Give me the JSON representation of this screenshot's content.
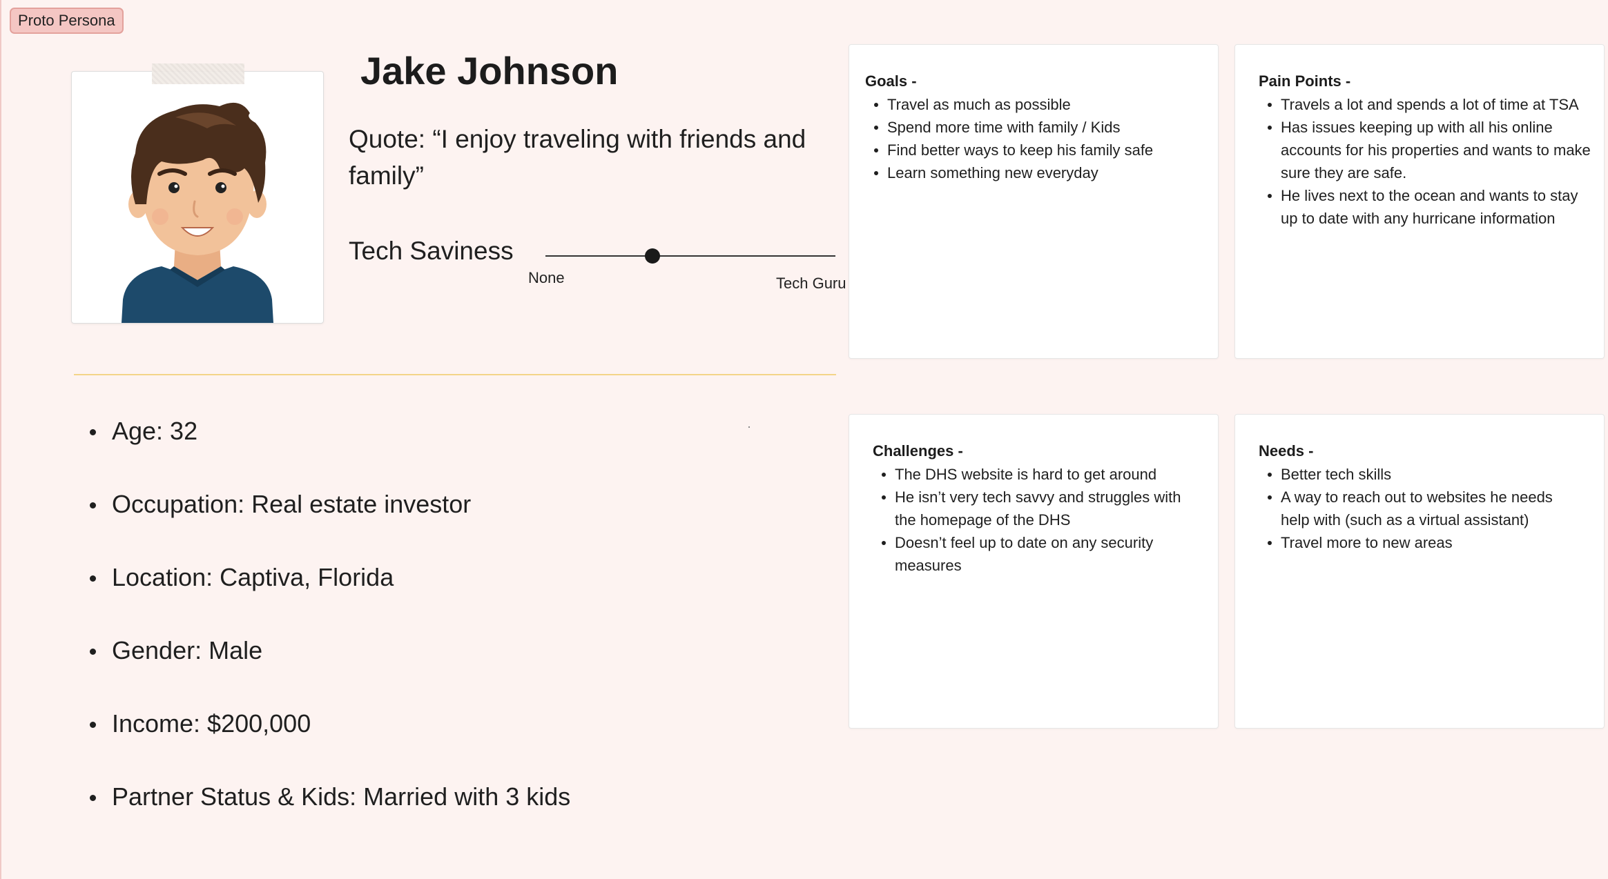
{
  "frame_tag": "Proto Persona",
  "persona": {
    "name": "Jake Johnson",
    "quote": "Quote: “I enjoy traveling with friends and family”",
    "tech": {
      "label": "Tech Saviness",
      "min_label": "None",
      "max_label": "Tech Guru",
      "level": 0.37
    }
  },
  "facts": [
    "Age: 32",
    "Occupation: Real estate investor",
    "Location: Captiva, Florida",
    "Gender: Male",
    "Income: $200,000",
    "Partner Status & Kids: Married with 3 kids"
  ],
  "cards": {
    "goals": {
      "title": "Goals -",
      "items": [
        "Travel as much as possible",
        "Spend more time with family / Kids",
        "Find better ways to keep his family safe",
        "Learn something new everyday"
      ]
    },
    "pain_points": {
      "title": "Pain Points -",
      "items": [
        "Travels a lot and spends a lot of time at TSA",
        "Has issues keeping up with all his online accounts for his properties and wants to make sure they are safe.",
        "He lives next to the ocean and wants to stay up to date with any hurricane information"
      ]
    },
    "challenges": {
      "title": "Challenges -",
      "items": [
        "The DHS website is hard to get around",
        "He isn’t very tech savvy and struggles with the homepage of the DHS",
        "Doesn’t feel up to date on any security measures"
      ]
    },
    "needs": {
      "title": "Needs -",
      "items": [
        "Better tech skills",
        "A way to reach out to websites he needs help with (such as a virtual assistant)",
        "Travel more to new areas"
      ]
    }
  },
  "colors": {
    "background": "#fdf3f1",
    "divider": "#f3d488",
    "tag_fill": "#f4c6c3",
    "shirt": "#1d4a6b",
    "hair": "#4a2e1c",
    "skin": "#f2c29a"
  },
  "icons": {
    "avatar": "persona-avatar-illustration"
  }
}
